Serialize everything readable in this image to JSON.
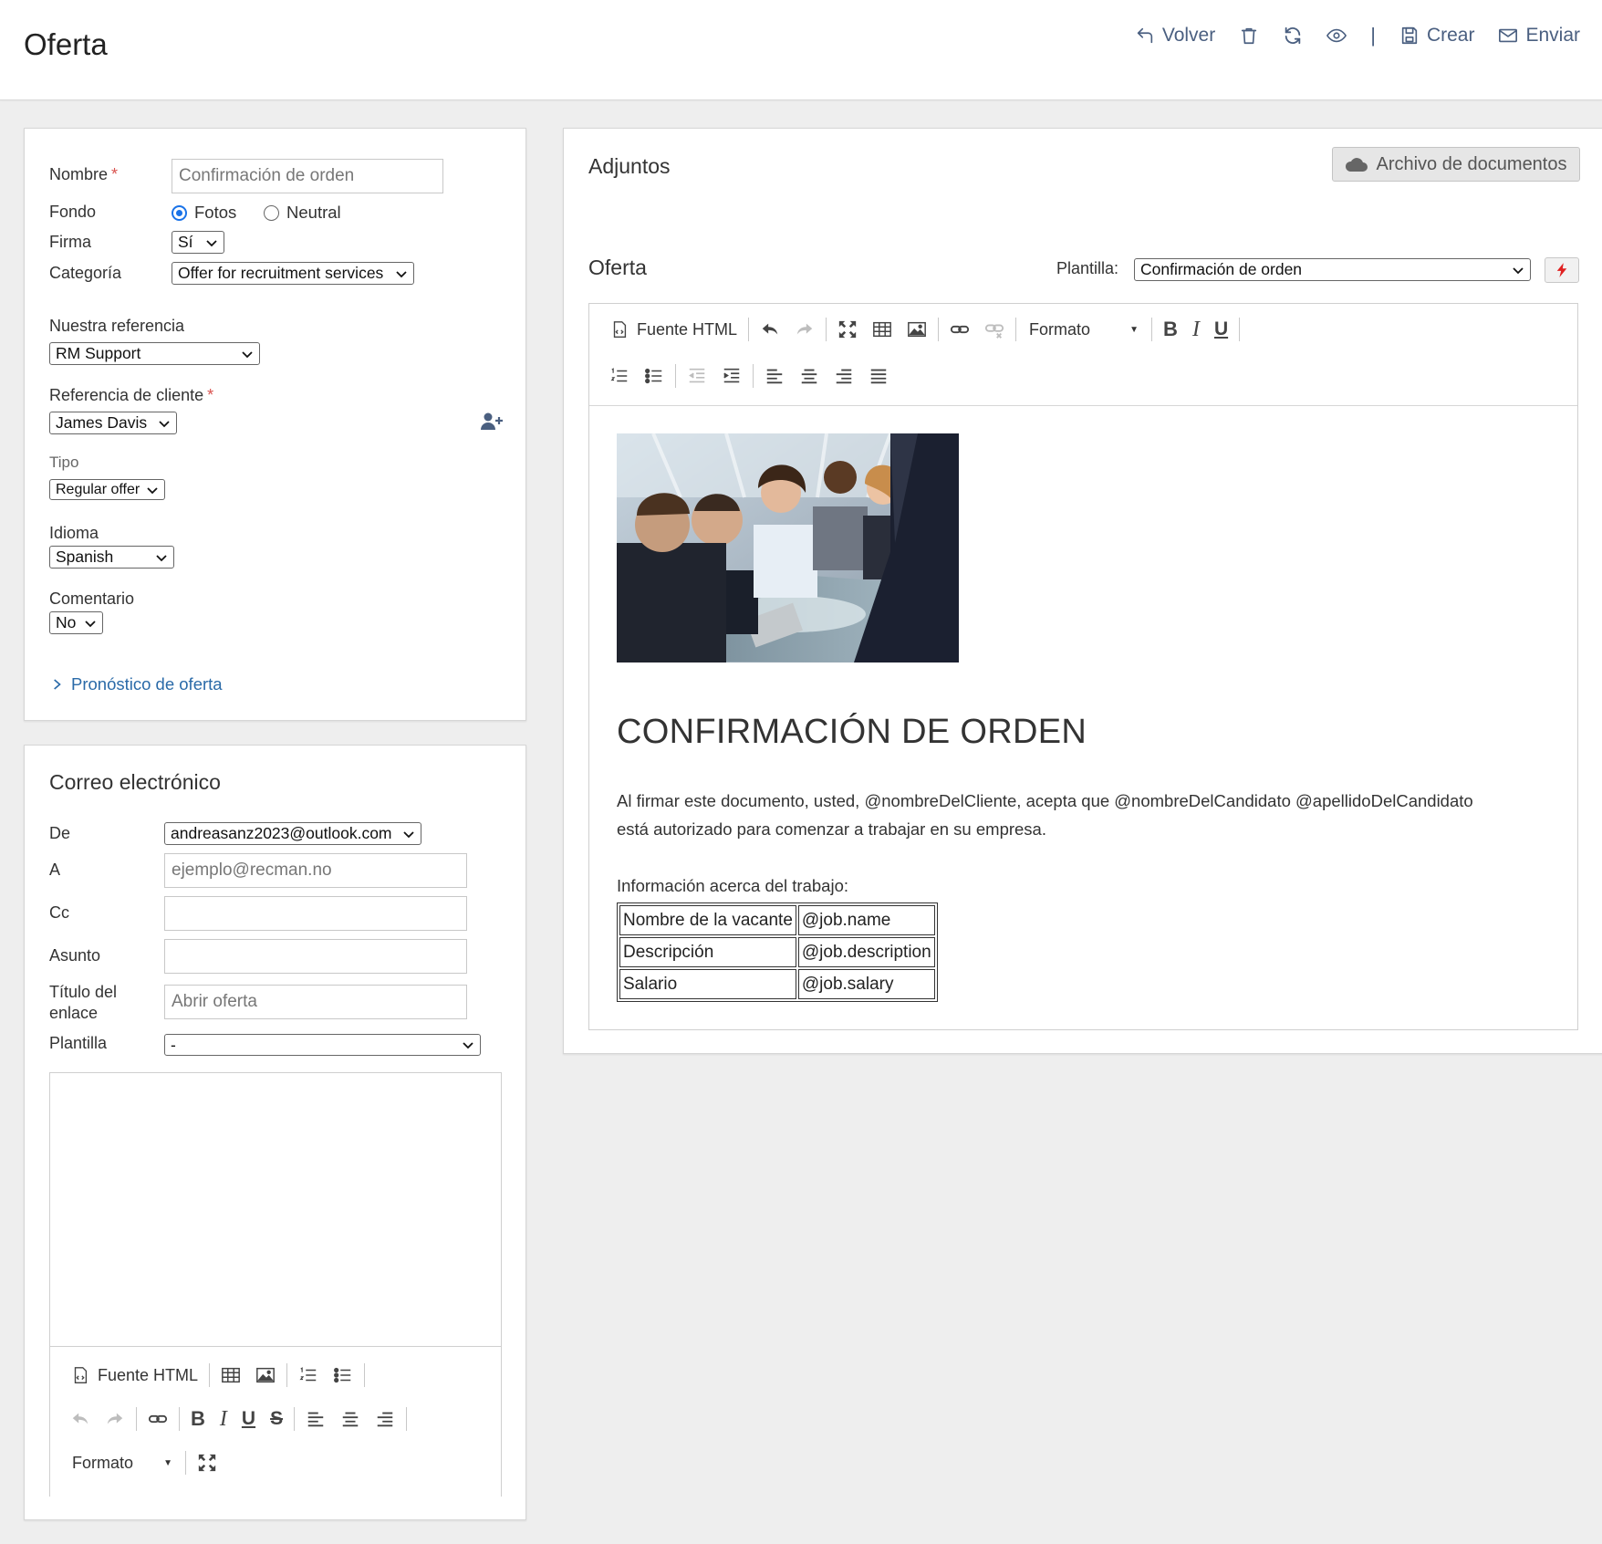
{
  "header": {
    "title": "Oferta",
    "actions": {
      "back": "Volver",
      "separator": "|",
      "create": "Crear",
      "send": "Enviar"
    }
  },
  "form": {
    "name_label": "Nombre",
    "required_mark": "*",
    "name_placeholder": "Confirmación de orden",
    "background_label": "Fondo",
    "background_options": [
      "Fotos",
      "Neutral"
    ],
    "background_selected": "Fotos",
    "signature_label": "Firma",
    "signature_value": "Sí",
    "category_label": "Categoría",
    "category_value": "Offer for recruitment services",
    "our_ref_label": "Nuestra referencia",
    "our_ref_value": "RM Support",
    "client_ref_label": "Referencia de cliente",
    "client_ref_value": "James Davis",
    "type_label": "Tipo",
    "type_value": "Regular offer",
    "language_label": "Idioma",
    "language_value": "Spanish",
    "comment_label": "Comentario",
    "comment_value": "No",
    "forecast_link": "Pronóstico de oferta"
  },
  "email": {
    "title": "Correo electrónico",
    "from_label": "De",
    "from_value": "andreasanz2023@outlook.com",
    "to_label": "A",
    "to_placeholder": "ejemplo@recman.no",
    "cc_label": "Cc",
    "subject_label": "Asunto",
    "link_title_label_1": "Título del",
    "link_title_label_2": "enlace",
    "link_title_placeholder": "Abrir oferta",
    "template_label": "Plantilla",
    "template_value": "-",
    "toolbar": {
      "html_source": "Fuente HTML",
      "format": "Formato"
    }
  },
  "attachments": {
    "title": "Adjuntos",
    "archive_button": "Archivo de documentos"
  },
  "offer": {
    "title": "Oferta",
    "template_label": "Plantilla:",
    "template_value": "Confirmación de orden",
    "toolbar": {
      "html_source": "Fuente HTML",
      "format": "Formato"
    },
    "document": {
      "heading": "CONFIRMACIÓN DE ORDEN",
      "paragraph_line1": "Al firmar este documento, usted, @nombreDelCliente, acepta que @nombreDelCandidato @apellidoDelCandidato",
      "paragraph_line2": "está autorizado para comenzar a trabajar en su empresa.",
      "job_info_label": "Información acerca del trabajo:",
      "table": [
        [
          "Nombre de la vacante",
          "@job.name"
        ],
        [
          "Descripción",
          "@job.description"
        ],
        [
          "Salario",
          "@job.salary"
        ]
      ]
    }
  },
  "colors": {
    "link": "#2a6aa8",
    "icon": "#4a5f80",
    "required": "#d9534f",
    "radio_accent": "#1a73e8",
    "flash": "#e02020"
  }
}
